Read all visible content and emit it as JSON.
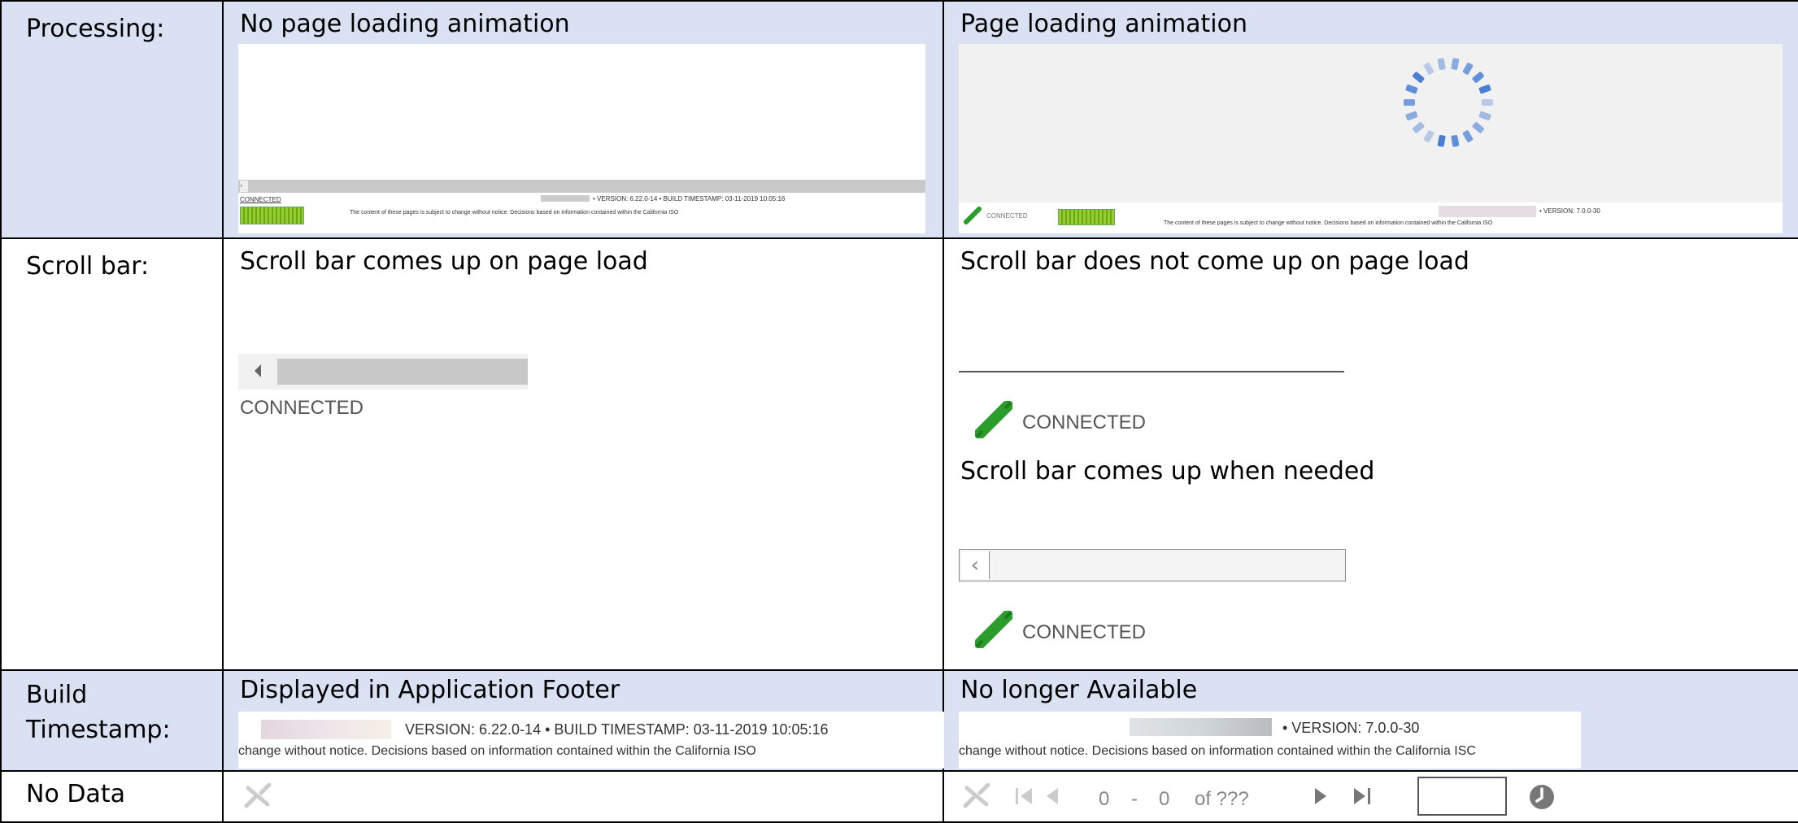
{
  "rows": {
    "processing": {
      "label": "Processing:",
      "old_heading": "No page loading animation",
      "new_heading": "Page loading animation",
      "old_footer": {
        "connected": "CONNECTED",
        "version_line": "• VERSION: 6.22.0-14 • BUILD TIMESTAMP: 03-11-2019 10:05:16",
        "notice": "The content of these pages is subject to change without notice. Decisions based on information contained within the California ISO"
      },
      "new_footer": {
        "connected": "CONNECTED",
        "version_line": "• VERSION: 7.0.0-30",
        "notice": "The content of these pages is subject to change without notice. Decisions based on information contained within the California ISO"
      }
    },
    "scrollbar": {
      "label": "Scroll bar:",
      "old_heading": "Scroll bar comes up on page load",
      "old_connected": "CONNECTED",
      "new_heading": "Scroll bar does not come up on page load",
      "new_connected": "CONNECTED",
      "new_subheading": "Scroll bar comes up when needed",
      "new_connected_2": "CONNECTED"
    },
    "build": {
      "label_line1": "Build",
      "label_line2": "Timestamp:",
      "old_heading": "Displayed in Application Footer",
      "old_version": "VERSION: 6.22.0-14  •  BUILD TIMESTAMP: 03-11-2019 10:05:16",
      "old_notice": "change without notice. Decisions based on information contained within the California ISO",
      "new_heading": "No longer Available",
      "new_version": "•  VERSION: 7.0.0-30",
      "new_notice": "change without notice. Decisions based on information contained within the California ISC"
    },
    "nodata": {
      "label": "No Data",
      "pager_from": "0",
      "pager_dash": "-",
      "pager_to": "0",
      "pager_of": "of ???"
    }
  },
  "colors": {
    "header_shade": "#d9e1f2",
    "spinner": "#4a7fd4",
    "plug": "#2a9d2a"
  },
  "icons": [
    "scroll-left-arrow-icon",
    "plug-connected-icon",
    "loading-spinner-icon",
    "pager-first-icon",
    "pager-prev-icon",
    "pager-next-icon",
    "pager-last-icon",
    "refresh-icon",
    "disconnected-icon"
  ]
}
